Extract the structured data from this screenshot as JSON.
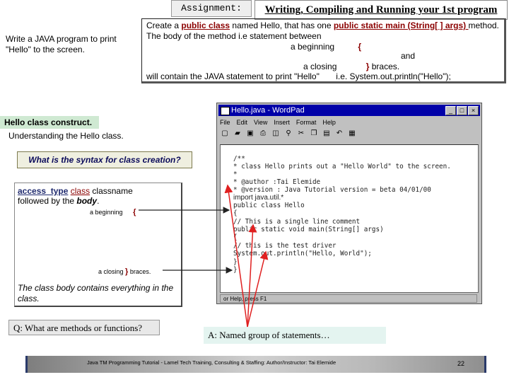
{
  "header": {
    "assignment_label": "Assignment:",
    "title": "Writing, Compiling and Running your 1st program"
  },
  "left_prompt": "Write a JAVA program to print \"Hello\" to the screen.",
  "description": {
    "line1_pre": "Create a ",
    "line1_kw1": "public class",
    "line1_mid": " named Hello, that has one ",
    "line1_kw2": "public static main (String[ ] args) ",
    "line1_post": "method.",
    "line2": "The body of the method i.e statement between",
    "line3_text": "a  beginning",
    "line3_brace": "{",
    "line4": "and",
    "line5_text": "a closing",
    "line5_brace": "}",
    "line5_post": "braces.",
    "line6_left": "will contain the JAVA statement to print \"Hello\"",
    "line6_right": "i.e. System.out.println(\"Hello\");"
  },
  "hello_section": {
    "header": "Hello class construct.",
    "subheader": "Understanding the Hello class.",
    "syntax_button": "What is the syntax for class creation?"
  },
  "syntax_box": {
    "access_type": "access_type",
    "class_kw": "class",
    "classname": " classname",
    "followed": "followed by the ",
    "body": "body",
    "period": ".",
    "begin_text": "a  beginning",
    "begin_brace": "{",
    "close_text": "a closing",
    "close_brace": "}",
    "close_post": "braces.",
    "body_note": "The class body contains everything in the class."
  },
  "qa": {
    "question": "Q: What are methods or functions?",
    "answer": "A: Named group of statements…"
  },
  "footer": {
    "text": "Java TM Programming Tutorial - Lamel Tech Training, Consulting & Staffing: Author/Instructor: Tai Elemide",
    "page_number": "22"
  },
  "wordpad": {
    "title": "Hello.java - WordPad",
    "menu": [
      "File",
      "Edit",
      "View",
      "Insert",
      "Format",
      "Help"
    ],
    "toolbar_icons": [
      "new-icon",
      "open-icon",
      "save-icon",
      "print-icon",
      "preview-icon",
      "find-icon",
      "cut-icon",
      "copy-icon",
      "paste-icon",
      "undo-icon",
      "date-icon"
    ],
    "code_lines": [
      "/**",
      " *  class Hello prints out a \"Hello World\" to the screen.",
      " *",
      " * @author :Tai Elemide",
      " * @version : Java Tutorial version = beta 04/01/00",
      "import java.util.*",
      "public class Hello",
      "{",
      "      // This is a single line comment",
      "      public static void main(String[] args)",
      "      {",
      "         // this is the test driver",
      "         System.out.println(\"Hello, World\");",
      "      }",
      "}"
    ],
    "status": "or Help, press F1"
  },
  "colors": {
    "accent_red": "#8b0000",
    "arrow_red": "#e02020",
    "header_green": "#cfe9d2",
    "answer_teal": "#e4f4f0",
    "titlebar_blue": "#0000a8"
  }
}
